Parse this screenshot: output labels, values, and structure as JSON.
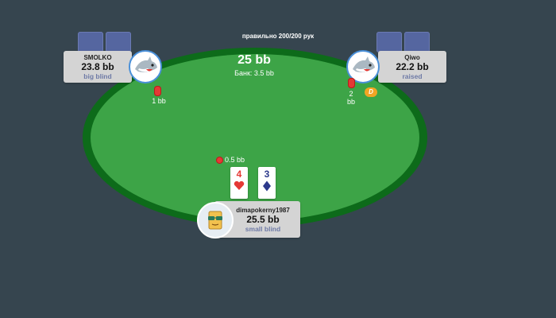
{
  "header": {
    "hand_counter": "правильно 200/200 рук"
  },
  "pot": {
    "total": "25 bb",
    "bank": "Банк: 3.5 bb"
  },
  "players": {
    "top_left": {
      "name": "SMOLKO",
      "stack": "23.8 bb",
      "status": "big blind",
      "bet": "1 bb",
      "avatar": "shark-avatar"
    },
    "top_right": {
      "name": "Qiwo",
      "stack": "22.2 bb",
      "status": "raised",
      "bet_top": "2",
      "bet_bottom": "bb",
      "avatar": "shark-avatar"
    },
    "hero": {
      "name": "dimapokerny1987",
      "stack": "25.5 bb",
      "status": "small blind",
      "bet": "0.5 bb",
      "avatar": "sunglasses-avatar",
      "cards": [
        {
          "rank": "4",
          "suit": "♥",
          "color": "#e53935"
        },
        {
          "rank": "3",
          "suit": "♦",
          "color": "#2d3a8c"
        }
      ]
    }
  },
  "dealer_button": {
    "label": "D",
    "color": "#f2a524"
  },
  "colors": {
    "background": "#36454f",
    "felt": "#3da447",
    "rail": "#0d6b1a",
    "chip": "#e53935",
    "status_text": "#6e7aa6"
  }
}
